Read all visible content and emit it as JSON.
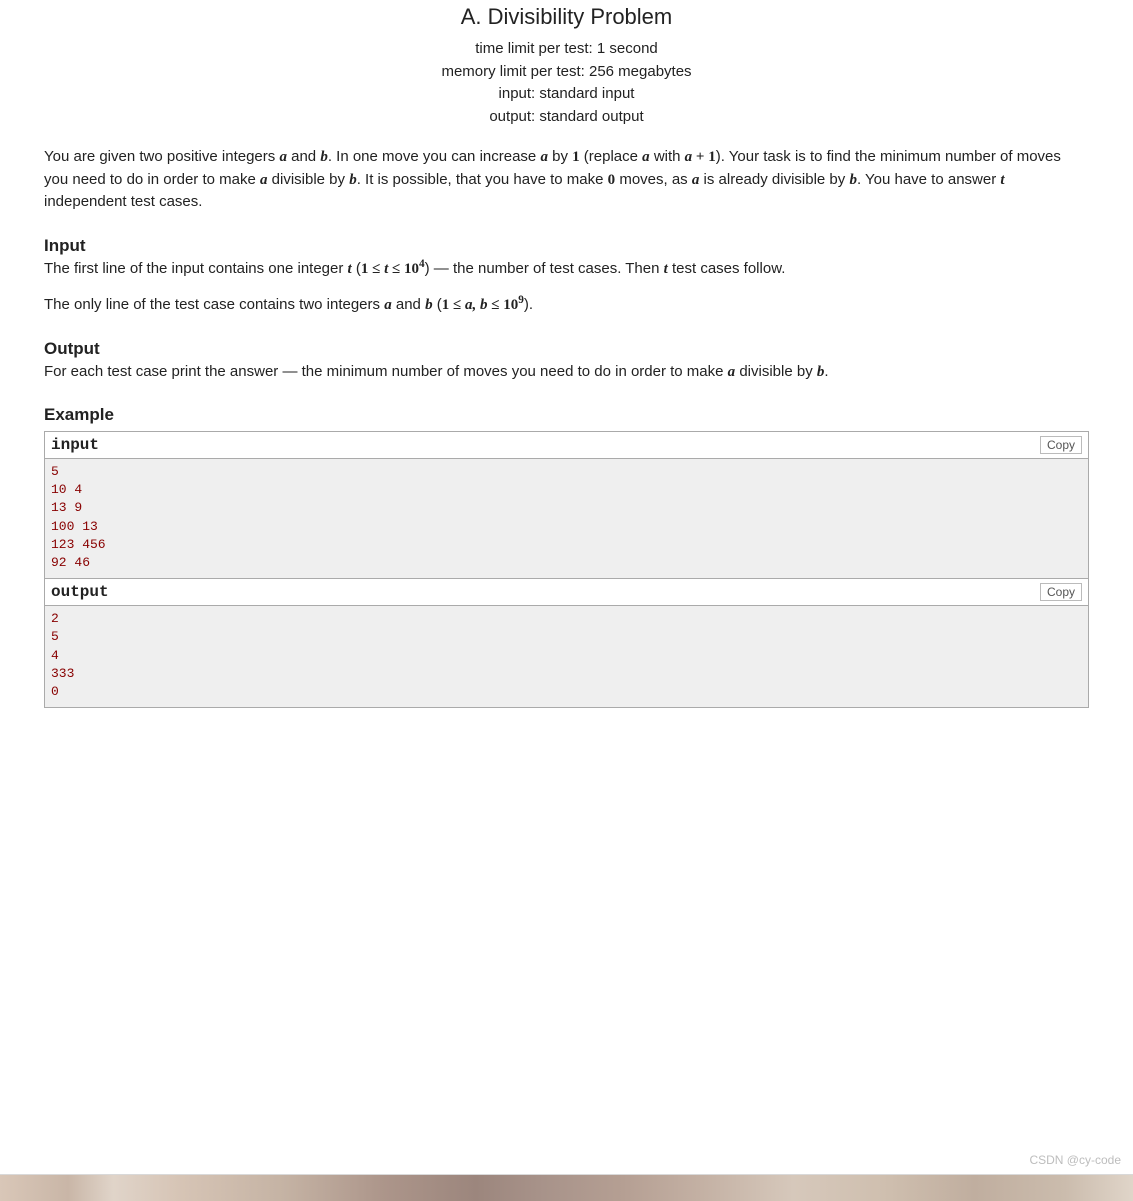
{
  "title": "A. Divisibility Problem",
  "meta": {
    "time": "time limit per test: 1 second",
    "memory": "memory limit per test: 256 megabytes",
    "input": "input: standard input",
    "output": "output: standard output"
  },
  "statement": {
    "p1_a": "You are given two positive integers ",
    "p1_b": " and ",
    "p1_c": ". In one move you can increase ",
    "p1_d": " by ",
    "p1_e": " (replace ",
    "p1_f": " with ",
    "p1_g": "). Your task is to find the minimum number of moves you need to do in order to make ",
    "p1_h": " divisible by ",
    "p1_i": ". It is possible, that you have to make ",
    "p1_j": " moves, as ",
    "p1_k": " is already divisible by ",
    "p1_l": ". You have to answer ",
    "p1_m": " independent test cases.",
    "var_a": "a",
    "var_b": "b",
    "var_t": "t",
    "num_1": "1",
    "num_0": "0",
    "aplus1_a": "a",
    "aplus1_plus": " + ",
    "aplus1_1": "1"
  },
  "input_heading": "Input",
  "input": {
    "p1_a": "The first line of the input contains one integer ",
    "p1_b": " (",
    "p1_c": ") — the number of test cases. Then ",
    "p1_d": " test cases follow.",
    "tbound_1": "1 ≤ ",
    "tbound_t": "t",
    "tbound_2": " ≤ 10",
    "tbound_exp": "4",
    "p2_a": "The only line of the test case contains two integers ",
    "p2_b": " and ",
    "p2_c": " (",
    "p2_d": ").",
    "abound_1": "1 ≤ ",
    "abound_ab": "a, b",
    "abound_2": " ≤ 10",
    "abound_exp": "9"
  },
  "output_heading": "Output",
  "output": {
    "p_a": "For each test case print the answer — the minimum number of moves you need to do in order to make ",
    "p_b": " divisible by ",
    "p_c": "."
  },
  "example_heading": "Example",
  "examples": {
    "input_label": "input",
    "output_label": "output",
    "copy_label": "Copy",
    "input_data": "5\n10 4\n13 9\n100 13\n123 456\n92 46",
    "output_data": "2\n5\n4\n333\n0"
  },
  "watermark": "CSDN @cy-code"
}
